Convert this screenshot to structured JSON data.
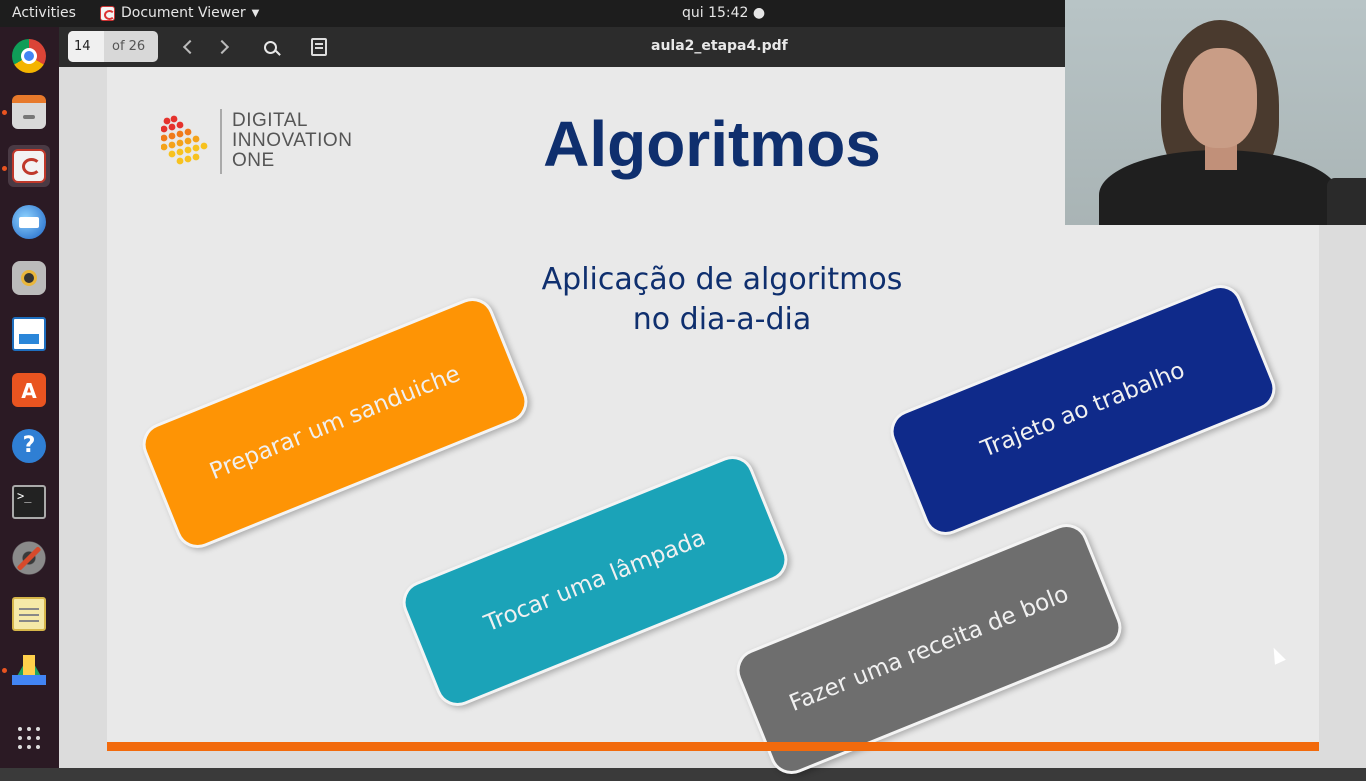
{
  "topbar": {
    "activities": "Activities",
    "app_name": "Document Viewer",
    "clock": "qui 15:42 ●"
  },
  "dock": {
    "items": [
      {
        "icon": "chrome-icon"
      },
      {
        "icon": "files-icon"
      },
      {
        "icon": "document-viewer-icon"
      },
      {
        "icon": "thunderbird-icon"
      },
      {
        "icon": "rhythmbox-icon"
      },
      {
        "icon": "libreoffice-writer-icon"
      },
      {
        "icon": "software-store-icon"
      },
      {
        "icon": "help-icon"
      },
      {
        "icon": "terminal-icon"
      },
      {
        "icon": "settings-icon"
      },
      {
        "icon": "text-editor-icon"
      },
      {
        "icon": "google-drive-icon"
      },
      {
        "icon": "show-applications-icon"
      }
    ]
  },
  "viewer": {
    "page_number": "14",
    "page_total": "of 26",
    "filename": "aula2_etapa4.pdf"
  },
  "slide": {
    "logo_lines": [
      "DIGITAL",
      "INNOVATION",
      "ONE"
    ],
    "title": "Algoritmos",
    "subtitle_line1": "Aplicação de algoritmos",
    "subtitle_line2": "no dia-a-dia",
    "cards": [
      {
        "label": "Preparar um sanduiche",
        "color": "#fe9405"
      },
      {
        "label": "Trocar uma lâmpada",
        "color": "#1ba3b8"
      },
      {
        "label": "Trajeto ao trabalho",
        "color": "#0f2a8a"
      },
      {
        "label": "Fazer uma receita de bolo",
        "color": "#6e6e6e"
      }
    ],
    "accent_bar_color": "#f26a0c"
  }
}
